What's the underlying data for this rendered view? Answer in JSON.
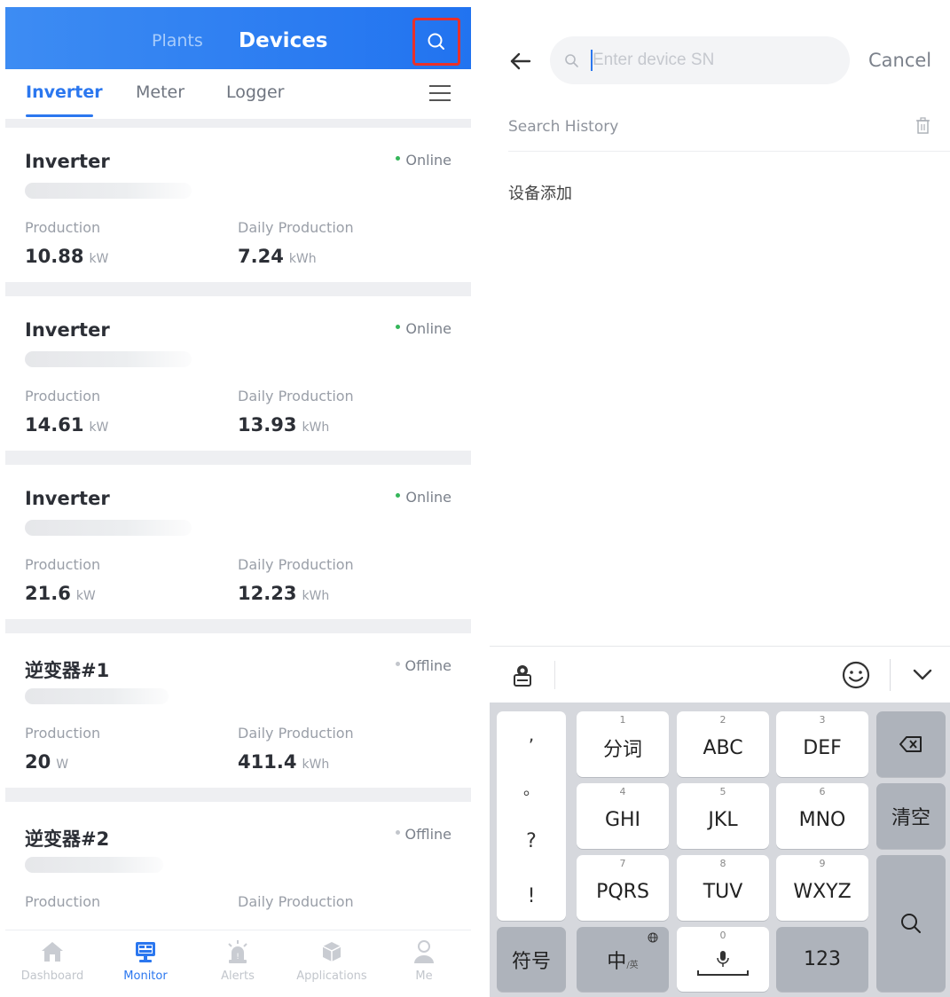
{
  "left": {
    "header": {
      "plants_label": "Plants",
      "devices_label": "Devices",
      "search_icon": "search-icon"
    },
    "subtabs": [
      {
        "label": "Inverter",
        "active": true
      },
      {
        "label": "Meter"
      },
      {
        "label": "Logger"
      }
    ],
    "menu_icon": "hamburger-menu-icon",
    "devices": [
      {
        "name": "Inverter",
        "status": "Online",
        "production_label": "Production",
        "production_value": "10.88",
        "production_unit": "kW",
        "daily_label": "Daily Production",
        "daily_value": "7.24",
        "daily_unit": "kWh"
      },
      {
        "name": "Inverter",
        "status": "Online",
        "production_label": "Production",
        "production_value": "14.61",
        "production_unit": "kW",
        "daily_label": "Daily Production",
        "daily_value": "13.93",
        "daily_unit": "kWh"
      },
      {
        "name": "Inverter",
        "status": "Online",
        "production_label": "Production",
        "production_value": "21.6",
        "production_unit": "kW",
        "daily_label": "Daily Production",
        "daily_value": "12.23",
        "daily_unit": "kWh"
      },
      {
        "name": "逆变器#1",
        "status": "Offline",
        "production_label": "Production",
        "production_value": "20",
        "production_unit": "W",
        "daily_label": "Daily Production",
        "daily_value": "411.4",
        "daily_unit": "kWh"
      },
      {
        "name": "逆变器#2",
        "status": "Offline",
        "production_label": "Production",
        "production_value": "",
        "production_unit": "",
        "daily_label": "Daily Production",
        "daily_value": "",
        "daily_unit": ""
      }
    ],
    "bottom_nav": [
      {
        "label": "Dashboard",
        "icon": "home-icon"
      },
      {
        "label": "Monitor",
        "icon": "monitor-icon",
        "active": true
      },
      {
        "label": "Alerts",
        "icon": "alarm-light-icon"
      },
      {
        "label": "Applications",
        "icon": "cube-icon"
      },
      {
        "label": "Me",
        "icon": "person-icon"
      }
    ]
  },
  "right": {
    "search": {
      "placeholder": "Enter device SN",
      "value": ""
    },
    "cancel_label": "Cancel",
    "history_title": "Search History",
    "history_items": [
      "设备添加"
    ],
    "keyboard": {
      "punctuation": [
        ",",
        "。",
        "?",
        "!"
      ],
      "keys": [
        {
          "num": "1",
          "label": "分词"
        },
        {
          "num": "2",
          "label": "ABC"
        },
        {
          "num": "3",
          "label": "DEF"
        },
        {
          "num": "4",
          "label": "GHI"
        },
        {
          "num": "5",
          "label": "JKL"
        },
        {
          "num": "6",
          "label": "MNO"
        },
        {
          "num": "7",
          "label": "PQRS"
        },
        {
          "num": "8",
          "label": "TUV"
        },
        {
          "num": "9",
          "label": "WXYZ"
        }
      ],
      "clear_label": "清空",
      "symbol_label": "符号",
      "lang_label": "中",
      "lang_sub": "/英",
      "space_num": "0",
      "num_label": "123"
    }
  },
  "colors": {
    "accent": "#2b77ef",
    "online": "#35b65a",
    "highlight_box": "#e9302a"
  }
}
